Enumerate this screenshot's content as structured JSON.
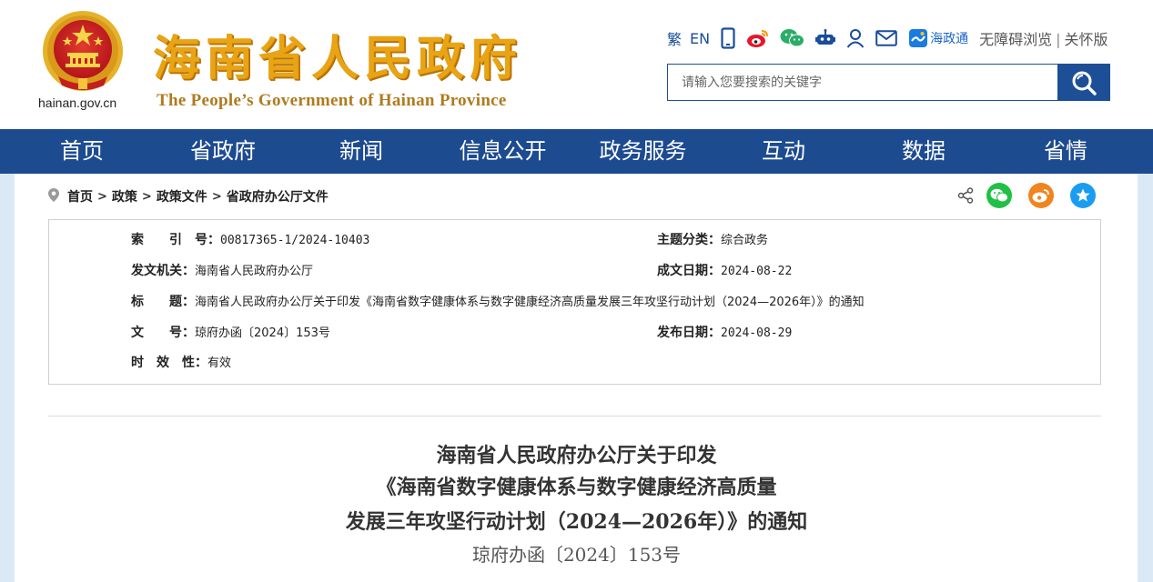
{
  "header": {
    "domain": "hainan.gov.cn",
    "title_cn": "海南省人民政府",
    "title_en": "The People’s Government  of Hainan Province",
    "tools": {
      "traditional": "繁",
      "english": "EN",
      "haizhengtong": "海政通",
      "accessible": "无障碍浏览",
      "separator": "|",
      "care": "关怀版"
    },
    "search": {
      "placeholder": "请输入您要搜索的关键字"
    },
    "colors": {
      "title": "#e8a414",
      "nav": "#1d4b8f",
      "brand_blue": "#1d4f96"
    }
  },
  "nav": [
    "首页",
    "省政府",
    "新闻",
    "信息公开",
    "政务服务",
    "互动",
    "数据",
    "省情"
  ],
  "breadcrumb": [
    "首页",
    "政策",
    "政策文件",
    "省政府办公厅文件"
  ],
  "share": [
    "share-icon",
    "wechat-icon",
    "weibo-icon",
    "favorite-icon"
  ],
  "meta": {
    "index_label": "索　　引　号：",
    "index_value": "00817365-1/2024-10403",
    "category_label": "主题分类：",
    "category_value": "综合政务",
    "issuer_label": "发文机关：",
    "issuer_value": "海南省人民政府办公厅",
    "created_label": "成文日期：",
    "created_value": "2024-08-22",
    "title_label": "标　　题：",
    "title_value": "海南省人民政府办公厅关于印发《海南省数字健康体系与数字健康经济高质量发展三年攻坚行动计划（2024—2026年）》的通知",
    "docno_label": "文　　号：",
    "docno_value": "琼府办函〔2024〕153号",
    "published_label": "发布日期：",
    "published_value": "2024-08-29",
    "validity_label": "时　效　性：",
    "validity_value": "有效"
  },
  "document": {
    "title_lines": [
      "海南省人民政府办公厅关于印发",
      "《海南省数字健康体系与数字健康经济高质量",
      "发展三年攻坚行动计划（2024—2026年）》的通知"
    ],
    "doc_number": "琼府办函〔2024〕153号"
  }
}
